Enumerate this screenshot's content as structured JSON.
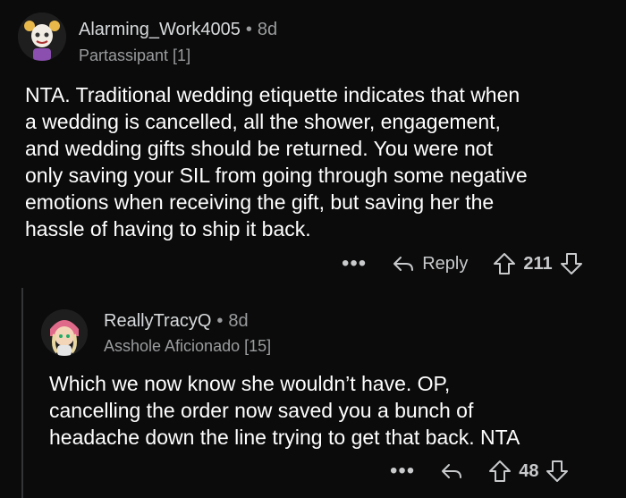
{
  "comments": [
    {
      "author": "Alarming_Work4005",
      "separator": "•",
      "age": "8d",
      "flair": "Partassipant [1]",
      "lines": [
        "NTA. Traditional wedding etiquette indicates that when",
        "a wedding is cancelled, all the shower, engagement,",
        "and wedding gifts should be returned.  You were not",
        "only saving your SIL from going through some negative",
        "emotions when receiving the gift, but saving her the",
        "hassle of having to ship it back."
      ],
      "more": "•••",
      "reply_label": "Reply",
      "score": "211"
    },
    {
      "author": "ReallyTracyQ",
      "separator": "•",
      "age": "8d",
      "flair": "Asshole Aficionado [15]",
      "lines": [
        "Which we now know she wouldn’t have. OP,",
        "cancelling the order now saved you a bunch of",
        "headache down the line trying to get that back. NTA"
      ],
      "more": "•••",
      "score": "48"
    }
  ],
  "colors": {
    "background": "#0b0b0b",
    "text": "#ffffff",
    "meta": "#9a9c9e",
    "thread_line": "#343536"
  },
  "icons": [
    "reply-arrow-icon",
    "upvote-arrow-icon",
    "downvote-arrow-icon"
  ]
}
